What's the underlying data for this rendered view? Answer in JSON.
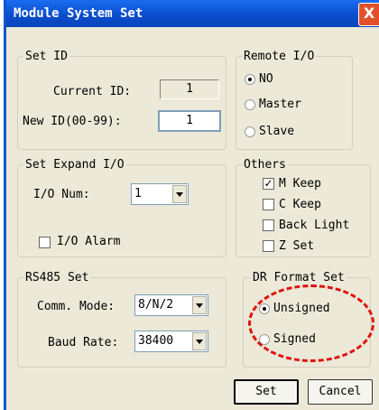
{
  "window": {
    "title": "Module System Set",
    "close_label": "X"
  },
  "set_id": {
    "legend": "Set ID",
    "current_label": "Current ID:",
    "current_value": "1",
    "new_label": "New ID(00-99):",
    "new_value": "1"
  },
  "remote_io": {
    "legend": "Remote I/O",
    "options": [
      "NO",
      "Master",
      "Slave"
    ],
    "selected": "NO"
  },
  "expand_io": {
    "legend": "Set Expand I/O",
    "num_label": "I/O Num:",
    "num_value": "1",
    "alarm_label": "I/O Alarm",
    "alarm_checked": false
  },
  "others": {
    "legend": "Others",
    "items": [
      {
        "label": "M Keep",
        "checked": true
      },
      {
        "label": "C Keep",
        "checked": false
      },
      {
        "label": "Back Light",
        "checked": false
      },
      {
        "label": "Z Set",
        "checked": false
      }
    ]
  },
  "rs485": {
    "legend": "RS485 Set",
    "comm_label": "Comm. Mode:",
    "comm_value": "8/N/2",
    "baud_label": "Baud Rate:",
    "baud_value": "38400"
  },
  "dr_format": {
    "legend": "DR Format Set",
    "options": [
      "Unsigned",
      "Signed"
    ],
    "selected": "Unsigned"
  },
  "buttons": {
    "set": "Set",
    "cancel": "Cancel"
  },
  "colors": {
    "titlebar": "#0a4ccc",
    "dialog_bg": "#ece9d8",
    "annotation": "#e01010",
    "close": "#e0512b"
  }
}
